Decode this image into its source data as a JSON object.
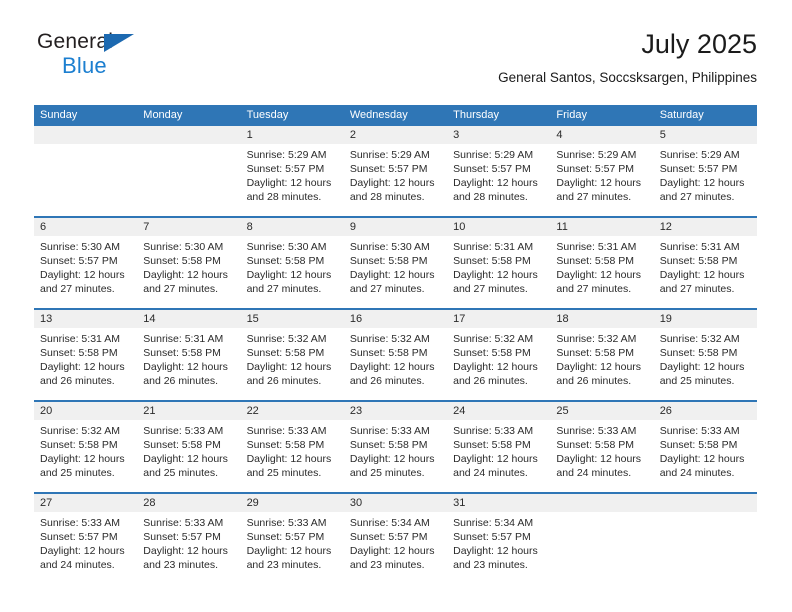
{
  "brand": {
    "name_part1": "General",
    "name_part2": "Blue",
    "triangle_color": "#1c69b0",
    "blue_color": "#1c7fd0"
  },
  "header": {
    "title": "July 2025",
    "subtitle": "General Santos, Soccsksargen, Philippines"
  },
  "calendar": {
    "header_bg": "#2f76b6",
    "daynum_bg": "#f0f0f0",
    "weekdays": [
      "Sunday",
      "Monday",
      "Tuesday",
      "Wednesday",
      "Thursday",
      "Friday",
      "Saturday"
    ],
    "weeks": [
      [
        {
          "day": "",
          "lines": []
        },
        {
          "day": "",
          "lines": []
        },
        {
          "day": "1",
          "lines": [
            "Sunrise: 5:29 AM",
            "Sunset: 5:57 PM",
            "Daylight: 12 hours",
            "and 28 minutes."
          ]
        },
        {
          "day": "2",
          "lines": [
            "Sunrise: 5:29 AM",
            "Sunset: 5:57 PM",
            "Daylight: 12 hours",
            "and 28 minutes."
          ]
        },
        {
          "day": "3",
          "lines": [
            "Sunrise: 5:29 AM",
            "Sunset: 5:57 PM",
            "Daylight: 12 hours",
            "and 28 minutes."
          ]
        },
        {
          "day": "4",
          "lines": [
            "Sunrise: 5:29 AM",
            "Sunset: 5:57 PM",
            "Daylight: 12 hours",
            "and 27 minutes."
          ]
        },
        {
          "day": "5",
          "lines": [
            "Sunrise: 5:29 AM",
            "Sunset: 5:57 PM",
            "Daylight: 12 hours",
            "and 27 minutes."
          ]
        }
      ],
      [
        {
          "day": "6",
          "lines": [
            "Sunrise: 5:30 AM",
            "Sunset: 5:57 PM",
            "Daylight: 12 hours",
            "and 27 minutes."
          ]
        },
        {
          "day": "7",
          "lines": [
            "Sunrise: 5:30 AM",
            "Sunset: 5:58 PM",
            "Daylight: 12 hours",
            "and 27 minutes."
          ]
        },
        {
          "day": "8",
          "lines": [
            "Sunrise: 5:30 AM",
            "Sunset: 5:58 PM",
            "Daylight: 12 hours",
            "and 27 minutes."
          ]
        },
        {
          "day": "9",
          "lines": [
            "Sunrise: 5:30 AM",
            "Sunset: 5:58 PM",
            "Daylight: 12 hours",
            "and 27 minutes."
          ]
        },
        {
          "day": "10",
          "lines": [
            "Sunrise: 5:31 AM",
            "Sunset: 5:58 PM",
            "Daylight: 12 hours",
            "and 27 minutes."
          ]
        },
        {
          "day": "11",
          "lines": [
            "Sunrise: 5:31 AM",
            "Sunset: 5:58 PM",
            "Daylight: 12 hours",
            "and 27 minutes."
          ]
        },
        {
          "day": "12",
          "lines": [
            "Sunrise: 5:31 AM",
            "Sunset: 5:58 PM",
            "Daylight: 12 hours",
            "and 27 minutes."
          ]
        }
      ],
      [
        {
          "day": "13",
          "lines": [
            "Sunrise: 5:31 AM",
            "Sunset: 5:58 PM",
            "Daylight: 12 hours",
            "and 26 minutes."
          ]
        },
        {
          "day": "14",
          "lines": [
            "Sunrise: 5:31 AM",
            "Sunset: 5:58 PM",
            "Daylight: 12 hours",
            "and 26 minutes."
          ]
        },
        {
          "day": "15",
          "lines": [
            "Sunrise: 5:32 AM",
            "Sunset: 5:58 PM",
            "Daylight: 12 hours",
            "and 26 minutes."
          ]
        },
        {
          "day": "16",
          "lines": [
            "Sunrise: 5:32 AM",
            "Sunset: 5:58 PM",
            "Daylight: 12 hours",
            "and 26 minutes."
          ]
        },
        {
          "day": "17",
          "lines": [
            "Sunrise: 5:32 AM",
            "Sunset: 5:58 PM",
            "Daylight: 12 hours",
            "and 26 minutes."
          ]
        },
        {
          "day": "18",
          "lines": [
            "Sunrise: 5:32 AM",
            "Sunset: 5:58 PM",
            "Daylight: 12 hours",
            "and 26 minutes."
          ]
        },
        {
          "day": "19",
          "lines": [
            "Sunrise: 5:32 AM",
            "Sunset: 5:58 PM",
            "Daylight: 12 hours",
            "and 25 minutes."
          ]
        }
      ],
      [
        {
          "day": "20",
          "lines": [
            "Sunrise: 5:32 AM",
            "Sunset: 5:58 PM",
            "Daylight: 12 hours",
            "and 25 minutes."
          ]
        },
        {
          "day": "21",
          "lines": [
            "Sunrise: 5:33 AM",
            "Sunset: 5:58 PM",
            "Daylight: 12 hours",
            "and 25 minutes."
          ]
        },
        {
          "day": "22",
          "lines": [
            "Sunrise: 5:33 AM",
            "Sunset: 5:58 PM",
            "Daylight: 12 hours",
            "and 25 minutes."
          ]
        },
        {
          "day": "23",
          "lines": [
            "Sunrise: 5:33 AM",
            "Sunset: 5:58 PM",
            "Daylight: 12 hours",
            "and 25 minutes."
          ]
        },
        {
          "day": "24",
          "lines": [
            "Sunrise: 5:33 AM",
            "Sunset: 5:58 PM",
            "Daylight: 12 hours",
            "and 24 minutes."
          ]
        },
        {
          "day": "25",
          "lines": [
            "Sunrise: 5:33 AM",
            "Sunset: 5:58 PM",
            "Daylight: 12 hours",
            "and 24 minutes."
          ]
        },
        {
          "day": "26",
          "lines": [
            "Sunrise: 5:33 AM",
            "Sunset: 5:58 PM",
            "Daylight: 12 hours",
            "and 24 minutes."
          ]
        }
      ],
      [
        {
          "day": "27",
          "lines": [
            "Sunrise: 5:33 AM",
            "Sunset: 5:57 PM",
            "Daylight: 12 hours",
            "and 24 minutes."
          ]
        },
        {
          "day": "28",
          "lines": [
            "Sunrise: 5:33 AM",
            "Sunset: 5:57 PM",
            "Daylight: 12 hours",
            "and 23 minutes."
          ]
        },
        {
          "day": "29",
          "lines": [
            "Sunrise: 5:33 AM",
            "Sunset: 5:57 PM",
            "Daylight: 12 hours",
            "and 23 minutes."
          ]
        },
        {
          "day": "30",
          "lines": [
            "Sunrise: 5:34 AM",
            "Sunset: 5:57 PM",
            "Daylight: 12 hours",
            "and 23 minutes."
          ]
        },
        {
          "day": "31",
          "lines": [
            "Sunrise: 5:34 AM",
            "Sunset: 5:57 PM",
            "Daylight: 12 hours",
            "and 23 minutes."
          ]
        },
        {
          "day": "",
          "lines": []
        },
        {
          "day": "",
          "lines": []
        }
      ]
    ]
  }
}
